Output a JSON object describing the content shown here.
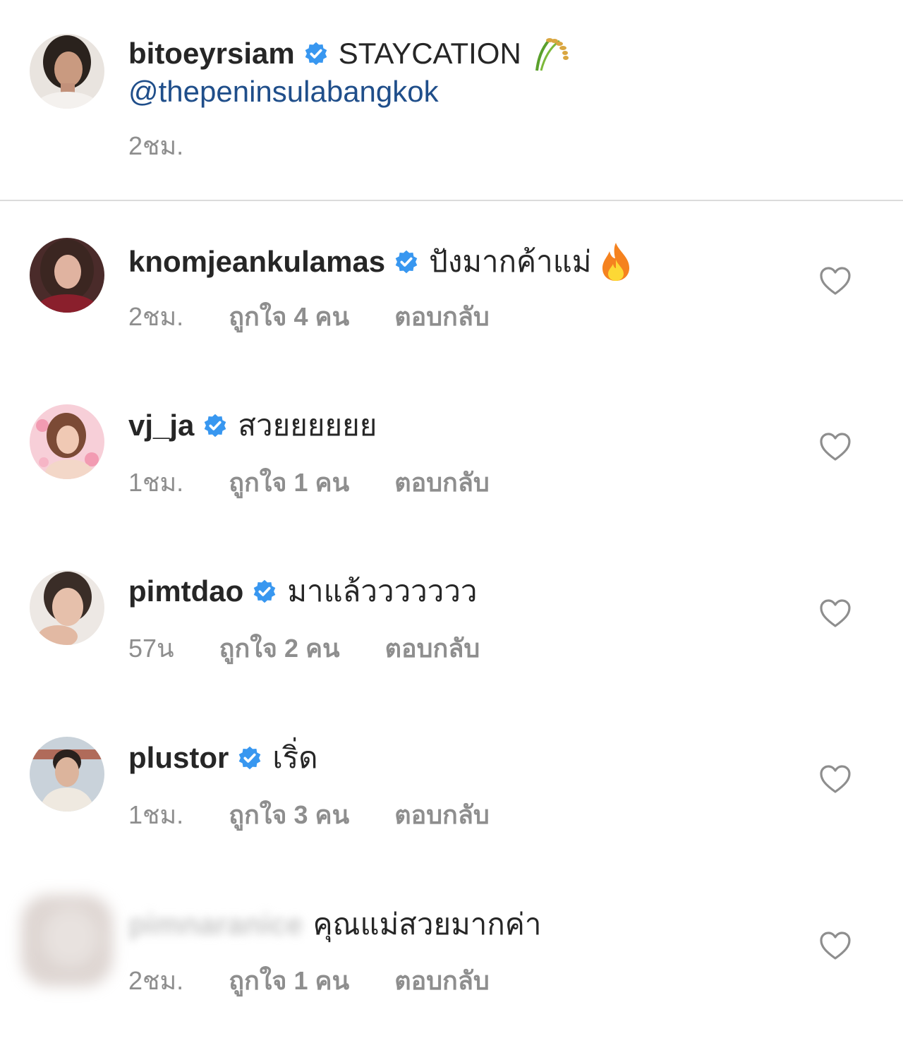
{
  "caption": {
    "username": "bitoeyrsiam",
    "text": "STAYCATION",
    "emoji": "rice-sheaf-icon",
    "mention": "@thepeninsulabangkok",
    "time": "2ชม."
  },
  "comments": [
    {
      "username": "knomjeankulamas",
      "verified": true,
      "text": "ปังมากค้าแม่",
      "emoji": "fire-icon",
      "time": "2ชม.",
      "likes": "ถูกใจ 4 คน",
      "reply": "ตอบกลับ"
    },
    {
      "username": "vj_ja",
      "verified": true,
      "text": "สวยยยยยย",
      "time": "1ชม.",
      "likes": "ถูกใจ 1 คน",
      "reply": "ตอบกลับ"
    },
    {
      "username": "pimtdao",
      "verified": true,
      "text": "มาแล้ววววววว",
      "time": "57น",
      "likes": "ถูกใจ 2 คน",
      "reply": "ตอบกลับ"
    },
    {
      "username": "plustor",
      "verified": true,
      "text": "เริ่ด",
      "time": "1ชม.",
      "likes": "ถูกใจ 3 คน",
      "reply": "ตอบกลับ"
    },
    {
      "username": "pimnaranice",
      "verified": false,
      "blurred": true,
      "text": "คุณแม่สวยมากค่า",
      "time": "2ชม.",
      "likes": "ถูกใจ 1 คน",
      "reply": "ตอบกลับ"
    }
  ],
  "colors": {
    "text": "#262626",
    "meta": "#8e8e8e",
    "mention": "#1f4e8a",
    "verified": "#3897f0",
    "divider": "#dbdbdb"
  }
}
